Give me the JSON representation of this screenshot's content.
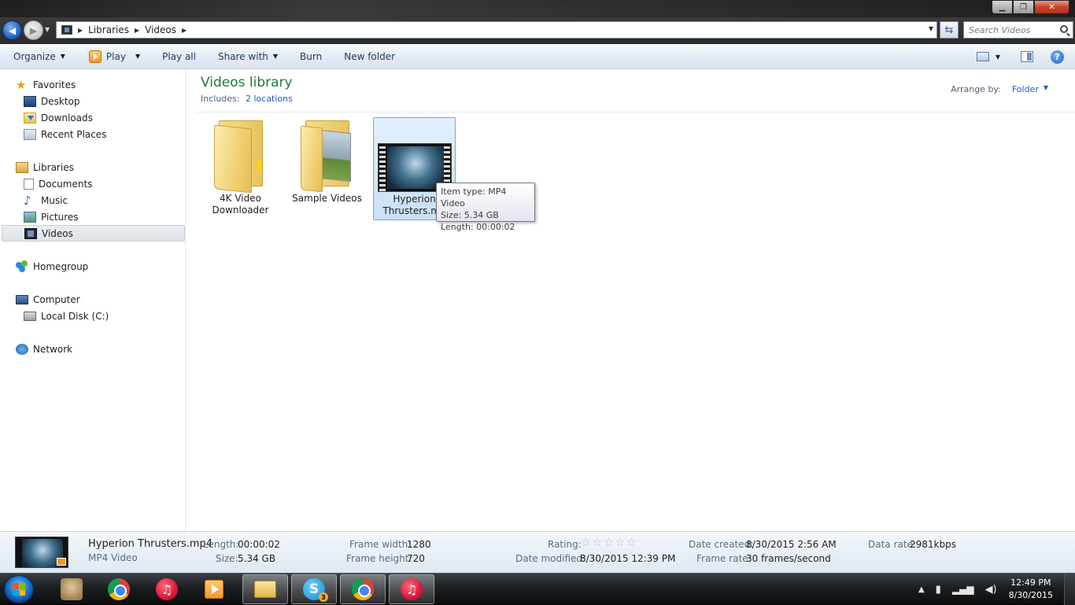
{
  "window": {
    "address": {
      "crumbs": [
        "Libraries",
        "Videos"
      ]
    },
    "search": {
      "placeholder": "Search Videos"
    },
    "controls": {
      "minimize": "▁",
      "maximize": "❐",
      "close": "✕"
    }
  },
  "toolbar": {
    "organize": "Organize",
    "play": "Play",
    "play_all": "Play all",
    "share_with": "Share with",
    "burn": "Burn",
    "new_folder": "New folder",
    "help": "?"
  },
  "sidebar": {
    "favorites": {
      "header": "Favorites",
      "items": [
        "Desktop",
        "Downloads",
        "Recent Places"
      ]
    },
    "libraries": {
      "header": "Libraries",
      "items": [
        "Documents",
        "Music",
        "Pictures",
        "Videos"
      ],
      "selected": "Videos"
    },
    "homegroup": "Homegroup",
    "computer": {
      "header": "Computer",
      "items": [
        "Local Disk (C:)"
      ]
    },
    "network": "Network"
  },
  "library": {
    "title": "Videos library",
    "includes_label": "Includes:",
    "includes_link": "2 locations",
    "arrange_label": "Arrange by:",
    "arrange_value": "Folder"
  },
  "items": [
    {
      "label": "4K Video Downloader",
      "kind": "folder"
    },
    {
      "label": "Sample Videos",
      "kind": "folder-with-photo"
    },
    {
      "label": "Hyperion Thrusters.mp4",
      "label_visible": "Hyperion Thrusters.mp",
      "kind": "video",
      "selected": true
    }
  ],
  "tooltip": {
    "line1": "Item type: MP4 Video",
    "line2": "Size: 5.34 GB",
    "line3": "Length: 00:00:02"
  },
  "details": {
    "name": "Hyperion Thrusters.mp4",
    "type": "MP4 Video",
    "length_label": "Length:",
    "length": "00:00:02",
    "size_label": "Size:",
    "size": "5.34 GB",
    "frame_width_label": "Frame width:",
    "frame_width": "1280",
    "frame_height_label": "Frame height:",
    "frame_height": "720",
    "rating_label": "Rating:",
    "rating": 0,
    "date_modified_label": "Date modified:",
    "date_modified": "8/30/2015 12:39 PM",
    "date_created_label": "Date created:",
    "date_created": "8/30/2015 2:56 AM",
    "frame_rate_label": "Frame rate:",
    "frame_rate": "30 frames/second",
    "data_rate_label": "Data rate:",
    "data_rate": "2981kbps"
  },
  "taskbar": {
    "pinned": [
      "pedro-icon",
      "chrome-icon",
      "itunes-icon",
      "media-player-icon",
      "explorer-icon",
      "skype-icon",
      "chrome-icon",
      "itunes-icon"
    ],
    "skype_badge": "3",
    "clock": {
      "time": "12:49 PM",
      "date": "8/30/2015"
    }
  }
}
